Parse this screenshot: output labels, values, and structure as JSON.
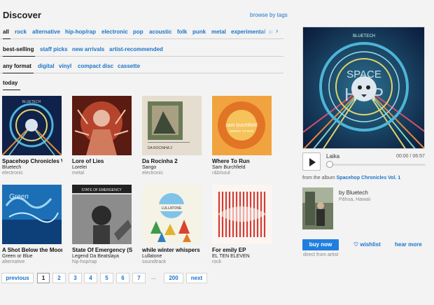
{
  "page": {
    "title": "Discover",
    "browse_link": "browse by tags"
  },
  "genres": [
    "all",
    "rock",
    "alternative",
    "hip-hop/rap",
    "electronic",
    "pop",
    "acoustic",
    "folk",
    "punk",
    "metal",
    "experimental",
    "ar"
  ],
  "sorts": [
    "best-selling",
    "staff picks",
    "new arrivals",
    "artist-recommended"
  ],
  "formats": [
    "any format",
    "digital",
    "vinyl",
    "compact disc",
    "cassette"
  ],
  "time": [
    "today"
  ],
  "albums": [
    {
      "title": "Spacehop Chronicles Vo",
      "artist": "Bluetech",
      "genre": "electronic"
    },
    {
      "title": "Lore of Lies",
      "artist": "Lorelei",
      "genre": "metal"
    },
    {
      "title": "Da Rocinha 2",
      "artist": "Sango",
      "genre": "electronic"
    },
    {
      "title": "Where To Run",
      "artist": "Sam Burchfield",
      "genre": "r&b/soul"
    },
    {
      "title": "A Shot Below the Moon",
      "artist": "Green or Blue",
      "genre": "alternative"
    },
    {
      "title": "State Of Emergency (Sin",
      "artist": "Legend Da Beatslaya",
      "genre": "hip-hop/rap"
    },
    {
      "title": "while winter whispers",
      "artist": "Lullatone",
      "genre": "soundtrack"
    },
    {
      "title": "For emily EP",
      "artist": "EL TEN ELEVEN",
      "genre": "rock"
    }
  ],
  "cover_text": {
    "bluetech": "BLUETECH",
    "space": "SPACE",
    "hop": "HOP",
    "rocinha": "DA ROCINHA 2",
    "sam": "sam burchfield",
    "where": "WHERE TO RUN",
    "state": "STATE OF EMERGENCY",
    "lullatone": "LULLATONE",
    "green": "Green"
  },
  "pagination": {
    "previous": "previous",
    "pages": [
      "1",
      "2",
      "3",
      "4",
      "5",
      "6",
      "7"
    ],
    "dots": "...",
    "last": "200",
    "next": "next"
  },
  "player": {
    "track": "Laika",
    "time": "00:00 / 06:57",
    "progress": 0,
    "from_prefix": "from the album",
    "album": "Spacehop Chronicles Vol. 1",
    "by": "by Bluetech",
    "location": "Pāhoa, Hawaii",
    "buy": "buy now",
    "wishlist": "wishlist",
    "hear_more": "hear more",
    "direct": "direct from artist"
  },
  "colors": {
    "link": "#1d74c9",
    "buy": "#1f7fe0"
  }
}
